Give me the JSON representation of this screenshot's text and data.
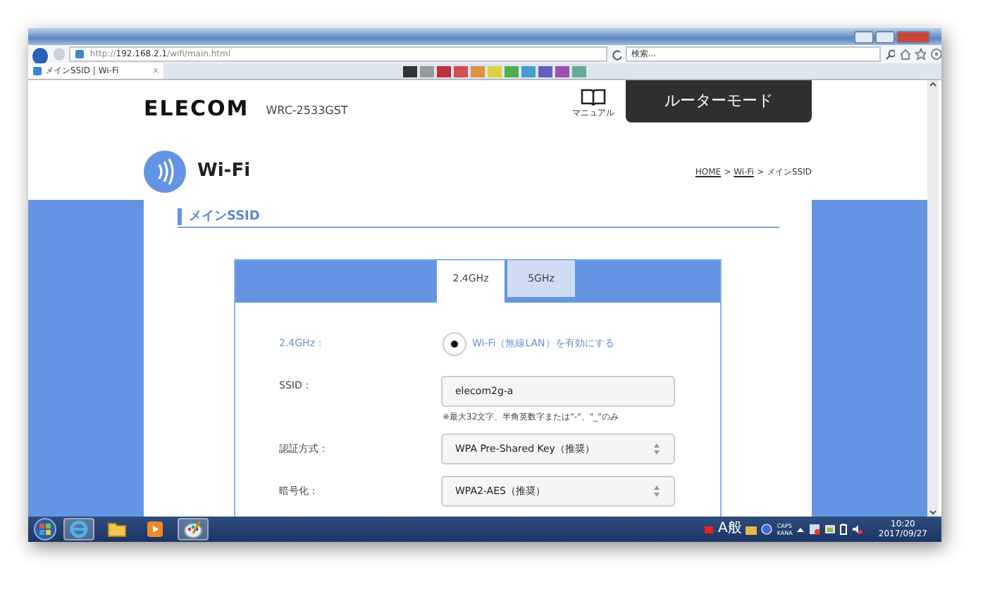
{
  "browser": {
    "url": "http://**192.168.2.1**/wifi/main.html",
    "search_placeholder": "検索...",
    "tabs": [
      {
        "label": "メインSSID | Wi-Fi",
        "selected": true,
        "close": "×"
      }
    ]
  },
  "header": {
    "logo": "ELECOM",
    "model": "WRC-2533GST",
    "manual_label": "マニュアル",
    "mode": "ルーターモード"
  },
  "page": {
    "title": "Wi-Fi",
    "breadcrumb_separator": ">",
    "breadcrumb": [
      {
        "label": "HOME",
        "link": true
      },
      {
        "label": "Wi-Fi",
        "link": true
      },
      {
        "label": "メインSSID",
        "link": false
      }
    ],
    "section_title": "メインSSID",
    "band_tabs": [
      {
        "label": "2.4GHz",
        "selected": true
      },
      {
        "label": "5GHz",
        "selected": false
      }
    ],
    "form": [
      {
        "kind": "radio",
        "label": "2.4GHz：",
        "option": "Wi-Fi（無線LAN）を有効にする",
        "checked": true
      },
      {
        "kind": "text",
        "label": "SSID：",
        "value": "elecom2g-a",
        "note": "※最大32文字、半角英数字または\"-\"、\"_\"のみ"
      },
      {
        "kind": "select",
        "label": "認証方式：",
        "value": "WPA Pre-Shared Key（推奨）"
      },
      {
        "kind": "select",
        "label": "暗号化：",
        "value": "WPA2-AES（推奨）"
      }
    ]
  },
  "taskbar": {
    "ime": "A般",
    "caps": "CAPS",
    "kana": "KANA",
    "time": "10:20",
    "date": "2017/09/27"
  }
}
